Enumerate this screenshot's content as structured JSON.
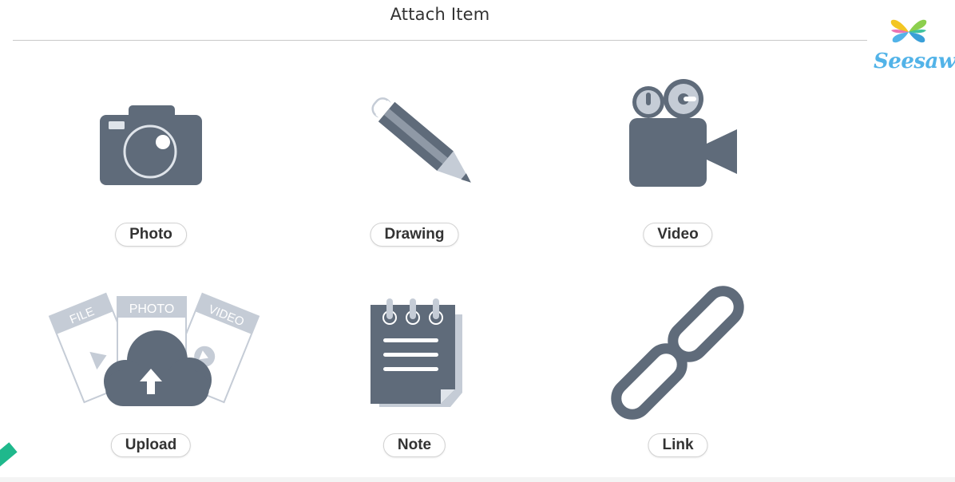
{
  "header": {
    "title": "Attach Item"
  },
  "logo": {
    "text": "Seesaw"
  },
  "items": [
    {
      "label": "Photo",
      "icon": "camera-icon"
    },
    {
      "label": "Drawing",
      "icon": "pencil-icon"
    },
    {
      "label": "Video",
      "icon": "video-camera-icon"
    },
    {
      "label": "Upload",
      "icon": "upload-cloud-icon",
      "card_labels": [
        "FILE",
        "PHOTO",
        "VIDEO"
      ]
    },
    {
      "label": "Note",
      "icon": "notepad-icon"
    },
    {
      "label": "Link",
      "icon": "link-icon"
    }
  ],
  "colors": {
    "icon": "#5f6b7a",
    "icon_light": "#c5ccd6",
    "logo_blue": "#52b3e8",
    "accent_green": "#1fb88c"
  }
}
